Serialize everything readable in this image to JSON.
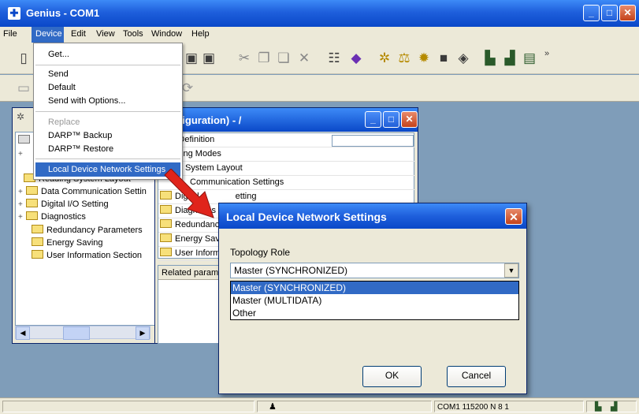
{
  "window": {
    "title": "Genius - COM1",
    "min_glyph": "_",
    "max_glyph": "□",
    "close_glyph": "✕"
  },
  "menubar": {
    "file": "File",
    "device": "Device",
    "edit": "Edit",
    "view": "View",
    "tools": "Tools",
    "window": "Window",
    "help": "Help"
  },
  "device_menu": {
    "get": "Get...",
    "send": "Send",
    "default": "Default",
    "send_options": "Send with Options...",
    "replace": "Replace",
    "darp_backup": "DARP™ Backup",
    "darp_restore": "DARP™ Restore",
    "local_network": "Local Device Network Settings"
  },
  "tree": {
    "items": [
      "Reading System Layout",
      "Data Communication Settin",
      "Digital I/O Setting",
      "Diagnostics",
      "Redundancy Parameters",
      "Energy Saving",
      "User Information Section"
    ]
  },
  "config_window": {
    "title": "nfiguration) - /",
    "rows": [
      "ode Definition",
      "perating Modes",
      "ading System Layout",
      "Communication Settings",
      "Digital",
      "Diagnoses",
      "Redundancy",
      "Energy Savi",
      "User Inform"
    ],
    "row4_tail": "etting",
    "related_label": "Related parame"
  },
  "dialog": {
    "title": "Local Device Network Settings",
    "close_glyph": "✕",
    "topology_label": "Topology Role",
    "selected_value": "Master (SYNCHRONIZED)",
    "options": [
      "Master (SYNCHRONIZED)",
      "Master (MULTIDATA)",
      "Other"
    ],
    "ok_label": "OK",
    "cancel_label": "Cancel"
  },
  "statusbar": {
    "connection": "COM1 115200 N 8 1"
  },
  "colors": {
    "title_blue": "#0a48c8",
    "highlight": "#316ac5",
    "arrow_red": "#e0241b"
  }
}
